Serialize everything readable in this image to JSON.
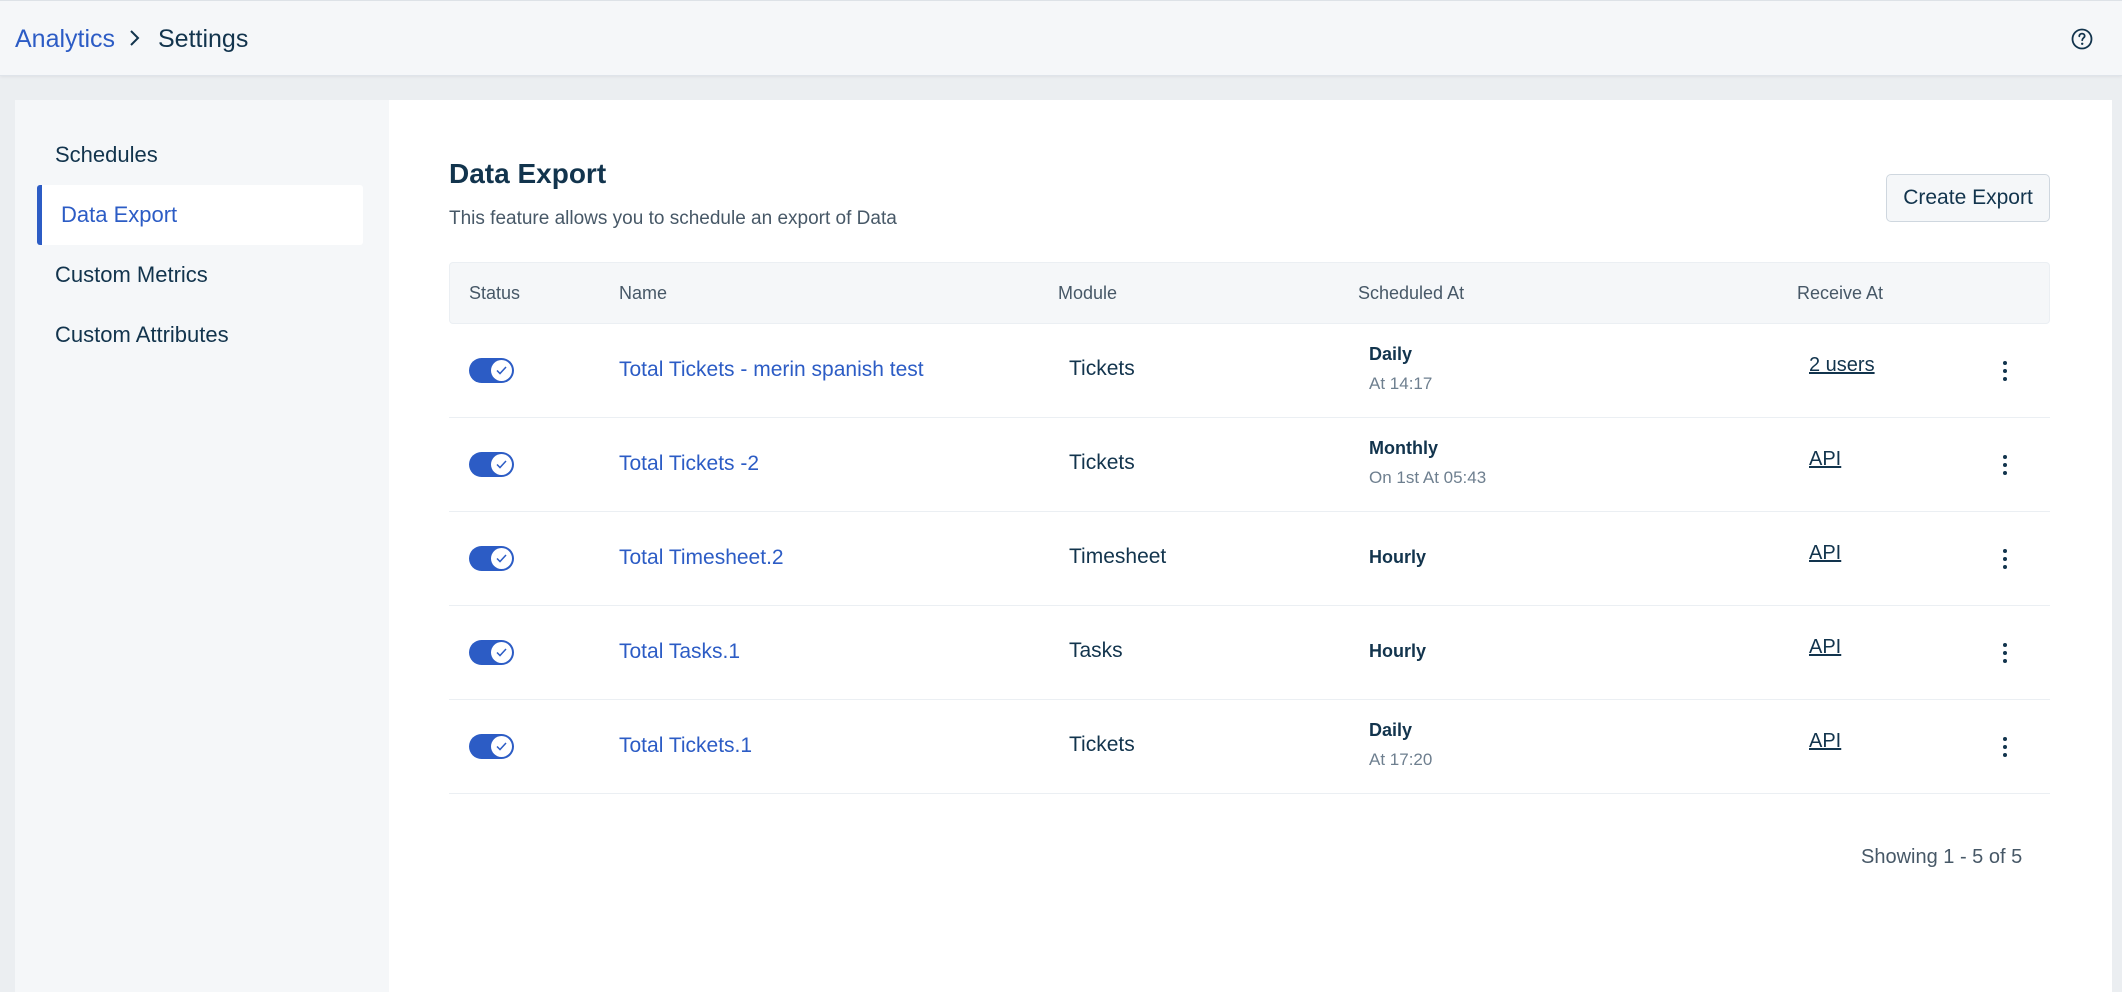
{
  "breadcrumb": {
    "root": "Analytics",
    "current": "Settings"
  },
  "sidebar": {
    "items": [
      {
        "label": "Schedules"
      },
      {
        "label": "Data Export"
      },
      {
        "label": "Custom Metrics"
      },
      {
        "label": "Custom Attributes"
      }
    ],
    "active_index": 1
  },
  "main": {
    "title": "Data Export",
    "subtitle": "This feature allows you to schedule an export of Data",
    "create_button": "Create Export"
  },
  "table": {
    "columns": [
      "Status",
      "Name",
      "Module",
      "Scheduled At",
      "Receive At"
    ],
    "rows": [
      {
        "enabled": true,
        "name": "Total Tickets - merin spanish test",
        "module": "Tickets",
        "frequency": "Daily",
        "schedule_detail": "At 14:17",
        "receive_at": "2 users"
      },
      {
        "enabled": true,
        "name": "Total Tickets -2",
        "module": "Tickets",
        "frequency": "Monthly",
        "schedule_detail": "On 1st At 05:43",
        "receive_at": "API"
      },
      {
        "enabled": true,
        "name": "Total Timesheet.2",
        "module": "Timesheet",
        "frequency": "Hourly",
        "schedule_detail": "",
        "receive_at": "API"
      },
      {
        "enabled": true,
        "name": "Total Tasks.1",
        "module": "Tasks",
        "frequency": "Hourly",
        "schedule_detail": "",
        "receive_at": "API"
      },
      {
        "enabled": true,
        "name": "Total Tickets.1",
        "module": "Tickets",
        "frequency": "Daily",
        "schedule_detail": "At 17:20",
        "receive_at": "API"
      }
    ]
  },
  "pagination": {
    "text": "Showing 1 - 5 of 5"
  },
  "colors": {
    "accent": "#2c5cc5",
    "text": "#12344d",
    "muted": "#475867"
  },
  "icons": {
    "breadcrumb_separator": "chevron-right-icon",
    "help": "help-circle-icon",
    "row_menu": "more-vertical-icon",
    "toggle_check": "check-icon"
  }
}
